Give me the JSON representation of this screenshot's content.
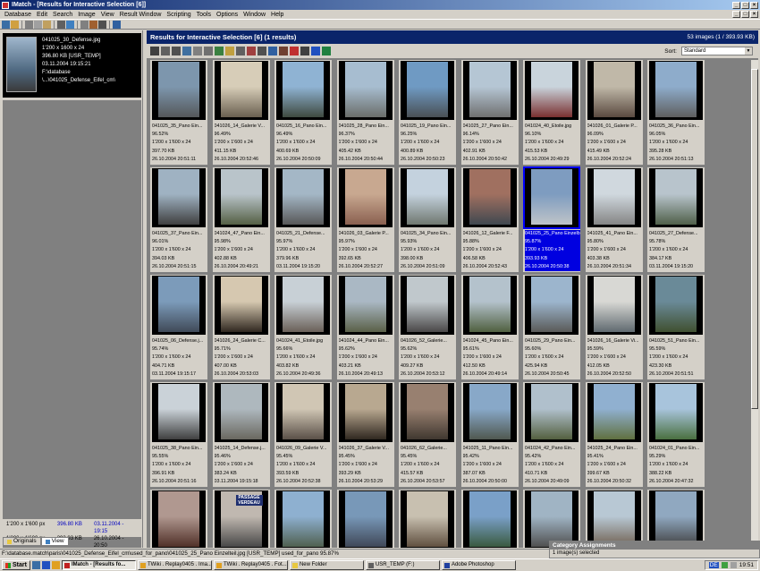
{
  "window": {
    "title": "IMatch - [Results for Interactive Selection [6]]",
    "buttons": [
      "_",
      "□",
      "×"
    ]
  },
  "menu": [
    "Database",
    "Edit",
    "Search",
    "Image",
    "View",
    "Result Window",
    "Scripting",
    "Tools",
    "Options",
    "Window",
    "Help"
  ],
  "preview": {
    "filename": "041025_30_Defense.jpg",
    "dims": "1'200 x 1600 x 24",
    "size": "396.80 KB [USR_TEMP]",
    "date": "03.11.2004 19:15:21",
    "path1": "F:\\database",
    "path2": "\\...\\041025_Defense_Eifel_cm\\"
  },
  "left_info": {
    "rows": [
      {
        "dims": "1'200 x 1'600 px",
        "size": "396.80 KB",
        "date": "03.11.2004 - 19:15"
      },
      {
        "dims": "1'200 x 1'600 px",
        "size": "393.93 KB",
        "date": "26.10.2004 - 20:50"
      }
    ],
    "tabs": [
      "Originals",
      "View"
    ]
  },
  "results": {
    "title": "Results for Interactive Selection [6]  (1 results)",
    "count": "53 images  (1 / 393.93 KB)",
    "sort_label": "Sort:",
    "sort_value": "Standard"
  },
  "colors": {
    "titlebar": "#0a246a",
    "selection": "#0000e0",
    "background": "#808080"
  },
  "thumbnails": [
    {
      "name": "041025_35_Pano Ein...",
      "pct": "96.52%",
      "dims": "1'200 x 1'600 x 24",
      "size": "397.70 KB",
      "date": "26.10.2004 20:51:11",
      "c1": "#7d96ad",
      "c2": "#55585a"
    },
    {
      "name": "041026_14_Galerie V...",
      "pct": "96.49%",
      "dims": "1'200 x 1'600 x 24",
      "size": "411.15 KB",
      "date": "26.10.2004 20:52:46",
      "c1": "#d7cdb8",
      "c2": "#6a6050"
    },
    {
      "name": "041025_16_Pano Ein...",
      "pct": "96.49%",
      "dims": "1'200 x 1'600 x 24",
      "size": "400.69 KB",
      "date": "26.10.2004 20:50:09",
      "c1": "#8fb3d3",
      "c2": "#3f4a40"
    },
    {
      "name": "041025_28_Pano Ein...",
      "pct": "96.37%",
      "dims": "1'200 x 1'600 x 24",
      "size": "405.42 KB",
      "date": "26.10.2004 20:50:44",
      "c1": "#a7bdd0",
      "c2": "#6b6e6a"
    },
    {
      "name": "041025_19_Pano Ein...",
      "pct": "96.25%",
      "dims": "1'200 x 1'600 x 24",
      "size": "400.89 KB",
      "date": "26.10.2004 20:50:23",
      "c1": "#6f9ac3",
      "c2": "#4a5055"
    },
    {
      "name": "041025_27_Pano Ein...",
      "pct": "96.14%",
      "dims": "1'200 x 1'600 x 24",
      "size": "402.91 KB",
      "date": "26.10.2004 20:50:42",
      "c1": "#b5c6d4",
      "c2": "#707070"
    },
    {
      "name": "041024_40_Etoile.jpg",
      "pct": "96.10%",
      "dims": "1'200 x 1'600 x 24",
      "size": "415.53 KB",
      "date": "26.10.2004 20:49:29",
      "c1": "#c9d4dc",
      "c2": "#7a3030"
    },
    {
      "name": "041026_01_Galerie P...",
      "pct": "96.09%",
      "dims": "1'200 x 1'600 x 24",
      "size": "415.49 KB",
      "date": "26.10.2004 20:52:24",
      "c1": "#c0b8a8",
      "c2": "#5a4a40"
    },
    {
      "name": "041025_36_Pano Ein...",
      "pct": "96.05%",
      "dims": "1'200 x 1'600 x 24",
      "size": "395.28 KB",
      "date": "26.10.2004 20:51:13",
      "c1": "#8eaccb",
      "c2": "#5f5f5f"
    },
    {
      "name": "041025_37_Pano Ein...",
      "pct": "96.01%",
      "dims": "1'200 x 1'600 x 24",
      "size": "394.03 KB",
      "date": "26.10.2004 20:51:15",
      "c1": "#9fb2c2",
      "c2": "#404040"
    },
    {
      "name": "041024_47_Pano Ein...",
      "pct": "95.98%",
      "dims": "1'200 x 1'600 x 24",
      "size": "402.88 KB",
      "date": "26.10.2004 20:49:21",
      "c1": "#b9c4ca",
      "c2": "#556045"
    },
    {
      "name": "041025_21_Defense...",
      "pct": "95.97%",
      "dims": "1'200 x 1'600 x 24",
      "size": "379.96 KB",
      "date": "03.11.2004 19:15:20",
      "c1": "#a4b7c6",
      "c2": "#585858"
    },
    {
      "name": "041026_03_Galerie P...",
      "pct": "95.97%",
      "dims": "1'200 x 1'600 x 24",
      "size": "392.65 KB",
      "date": "26.10.2004 20:52:27",
      "c1": "#c8a890",
      "c2": "#8a6050"
    },
    {
      "name": "041025_34_Pano Ein...",
      "pct": "95.93%",
      "dims": "1'200 x 1'600 x 24",
      "size": "398.00 KB",
      "date": "26.10.2004 20:51:09",
      "c1": "#c4d2de",
      "c2": "#707870"
    },
    {
      "name": "041026_12_Galerie F...",
      "pct": "95.88%",
      "dims": "1'200 x 1'600 x 24",
      "size": "406.58 KB",
      "date": "26.10.2004 20:52:43",
      "c1": "#a07060",
      "c2": "#404850"
    },
    {
      "name": "041025_25_Pano Einzelbild.jpg",
      "pct": "95.87%",
      "dims": "1'200 x 1'600 x 24",
      "size": "393.93 KB",
      "date": "26.10.2004 20:50:38",
      "c1": "#7e9cc0",
      "c2": "#bfc4c8"
    },
    {
      "name": "041025_41_Pano Ein...",
      "pct": "95.80%",
      "dims": "1'200 x 1'600 x 24",
      "size": "403.38 KB",
      "date": "26.10.2004 20:51:34",
      "c1": "#d0d8de",
      "c2": "#858585"
    },
    {
      "name": "041025_27_Defense...",
      "pct": "95.78%",
      "dims": "1'200 x 1'600 x 24",
      "size": "384.17 KB",
      "date": "03.11.2004 19:15:20",
      "c1": "#b8c4cc",
      "c2": "#50604a"
    },
    {
      "name": "041025_06_Defense.j...",
      "pct": "95.74%",
      "dims": "1'200 x 1'600 x 24",
      "size": "404.71 KB",
      "date": "03.11.2004 19:15:17",
      "c1": "#7c9bba",
      "c2": "#404a58"
    },
    {
      "name": "041026_24_Galerie C...",
      "pct": "95.71%",
      "dims": "1'200 x 1'600 x 24",
      "size": "407.00 KB",
      "date": "26.10.2004 20:53:03",
      "c1": "#d6c8b0",
      "c2": "#302820"
    },
    {
      "name": "041024_41_Etoile.jpg",
      "pct": "95.66%",
      "dims": "1'200 x 1'600 x 24",
      "size": "403.82 KB",
      "date": "26.10.2004 20:49:36",
      "c1": "#c8d0d6",
      "c2": "#6a6058"
    },
    {
      "name": "041024_44_Pano Ein...",
      "pct": "95.62%",
      "dims": "1'200 x 1'600 x 24",
      "size": "403.21 KB",
      "date": "26.10.2004 20:49:13",
      "c1": "#aab8c4",
      "c2": "#5a6048"
    },
    {
      "name": "041026_52_Galerie...",
      "pct": "95.62%",
      "dims": "1'200 x 1'600 x 24",
      "size": "409.27 KB",
      "date": "26.10.2004 20:53:12",
      "c1": "#c0c8cc",
      "c2": "#4a4848"
    },
    {
      "name": "041024_45_Pano Ein...",
      "pct": "95.61%",
      "dims": "1'200 x 1'600 x 24",
      "size": "412.50 KB",
      "date": "26.10.2004 20:49:14",
      "c1": "#b4c2cc",
      "c2": "#506040"
    },
    {
      "name": "041025_29_Pano Ein...",
      "pct": "95.60%",
      "dims": "1'200 x 1'600 x 24",
      "size": "425.94 KB",
      "date": "26.10.2004 20:50:45",
      "c1": "#9cb5cd",
      "c2": "#5a5a58"
    },
    {
      "name": "041026_16_Galerie Vi...",
      "pct": "95.59%",
      "dims": "1'200 x 1'600 x 24",
      "size": "412.05 KB",
      "date": "26.10.2004 20:52:50",
      "c1": "#d8d8d4",
      "c2": "#606a70"
    },
    {
      "name": "041025_51_Pano Ein...",
      "pct": "95.59%",
      "dims": "1'200 x 1'600 x 24",
      "size": "423.30 KB",
      "date": "26.10.2004 20:51:51",
      "c1": "#6a8a98",
      "c2": "#405030"
    },
    {
      "name": "041025_38_Pano Ein...",
      "pct": "95.55%",
      "dims": "1'200 x 1'600 x 24",
      "size": "396.91 KB",
      "date": "26.10.2004 20:51:16",
      "c1": "#cad2d8",
      "c2": "#404040"
    },
    {
      "name": "041025_14_Defense.j...",
      "pct": "95.46%",
      "dims": "1'200 x 1'600 x 24",
      "size": "383.24 KB",
      "date": "03.11.2004 19:15:18",
      "c1": "#aeb8be",
      "c2": "#6a6860"
    },
    {
      "name": "041026_09_Galerie V...",
      "pct": "95.45%",
      "dims": "1'200 x 1'600 x 24",
      "size": "393.59 KB",
      "date": "26.10.2004 20:52:38",
      "c1": "#d0c6b4",
      "c2": "#5a5048"
    },
    {
      "name": "041026_37_Galerie V...",
      "pct": "95.45%",
      "dims": "1'200 x 1'600 x 24",
      "size": "393.29 KB",
      "date": "26.10.2004 20:53:29",
      "c1": "#b8a890",
      "c2": "#302820"
    },
    {
      "name": "041026_62_Galerie...",
      "pct": "95.45%",
      "dims": "1'200 x 1'600 x 24",
      "size": "415.57 KB",
      "date": "26.10.2004 20:53:57",
      "c1": "#988070",
      "c2": "#403830"
    },
    {
      "name": "041025_11_Pano Ein...",
      "pct": "95.42%",
      "dims": "1'200 x 1'600 x 24",
      "size": "387.07 KB",
      "date": "26.10.2004 20:50:00",
      "c1": "#88a8c8",
      "c2": "#505850"
    },
    {
      "name": "041024_42_Pano Ein...",
      "pct": "95.42%",
      "dims": "1'200 x 1'600 x 24",
      "size": "410.71 KB",
      "date": "26.10.2004 20:49:09",
      "c1": "#b0c0cc",
      "c2": "#546040"
    },
    {
      "name": "041025_24_Pano Ein...",
      "pct": "95.41%",
      "dims": "1'200 x 1'600 x 24",
      "size": "399.67 KB",
      "date": "26.10.2004 20:50:32",
      "c1": "#90b0d0",
      "c2": "#607040"
    },
    {
      "name": "041024_01_Pano Ein...",
      "pct": "95.29%",
      "dims": "1'200 x 1'600 x 24",
      "size": "388.22 KB",
      "date": "26.10.2004 20:47:32",
      "c1": "#a8c4dc",
      "c2": "#4a7040"
    },
    {
      "name": "",
      "pct": "",
      "dims": "",
      "size": "",
      "date": "",
      "c1": "#b09890",
      "c2": "#503028"
    },
    {
      "name": "",
      "pct": "",
      "dims": "",
      "size": "",
      "date": "",
      "c1": "#c0b8b0",
      "c2": "#484848"
    },
    {
      "name": "",
      "pct": "",
      "dims": "",
      "size": "",
      "date": "",
      "c1": "#8eb0d0",
      "c2": "#506050"
    },
    {
      "name": "",
      "pct": "",
      "dims": "",
      "size": "",
      "date": "",
      "c1": "#7898b8",
      "c2": "#404858"
    },
    {
      "name": "",
      "pct": "",
      "dims": "",
      "size": "",
      "date": "",
      "c1": "#c8c0b0",
      "c2": "#605040"
    },
    {
      "name": "",
      "pct": "",
      "dims": "",
      "size": "",
      "date": "",
      "c1": "#7aa0c8",
      "c2": "#3a5a40"
    },
    {
      "name": "",
      "pct": "",
      "dims": "",
      "size": "",
      "date": "",
      "c1": "#a0b4c4",
      "c2": "#505050"
    },
    {
      "name": "",
      "pct": "",
      "dims": "",
      "size": "",
      "date": "",
      "c1": "#b8c8d4",
      "c2": "#706050"
    },
    {
      "name": "",
      "pct": "",
      "dims": "",
      "size": "",
      "date": "",
      "c1": "#90a8c0",
      "c2": "#404040"
    }
  ],
  "overlay_text": {
    "passage": "PASSAGE VERDEAU"
  },
  "category_panel": {
    "header": "Category Assignments",
    "text": "1 image(s) selected"
  },
  "statusbar": "F:\\database.match\\paris\\041025_Defense_Eifel_cm\\used_for_pano\\041025_25_Pano Einzelteil.jpg [USR_TEMP] used_for_pano 95.87%",
  "taskbar": {
    "start": "Start",
    "tasks": [
      {
        "label": "IMatch - [Results fo...",
        "color": "#c02020",
        "active": true
      },
      {
        "label": "TWiki . Replay0405 . Ima...",
        "color": "#e0a020",
        "active": false
      },
      {
        "label": "TWiki . Replay0405 . Fot...",
        "color": "#e0a020",
        "active": false
      },
      {
        "label": "New Folder",
        "color": "#e8c840",
        "active": false
      },
      {
        "label": "USR_TEMP (F:)",
        "color": "#606060",
        "active": false
      },
      {
        "label": "Adobe Photoshop",
        "color": "#2040a0",
        "active": false
      }
    ],
    "tray_lang": "DE",
    "clock": "19:51"
  }
}
